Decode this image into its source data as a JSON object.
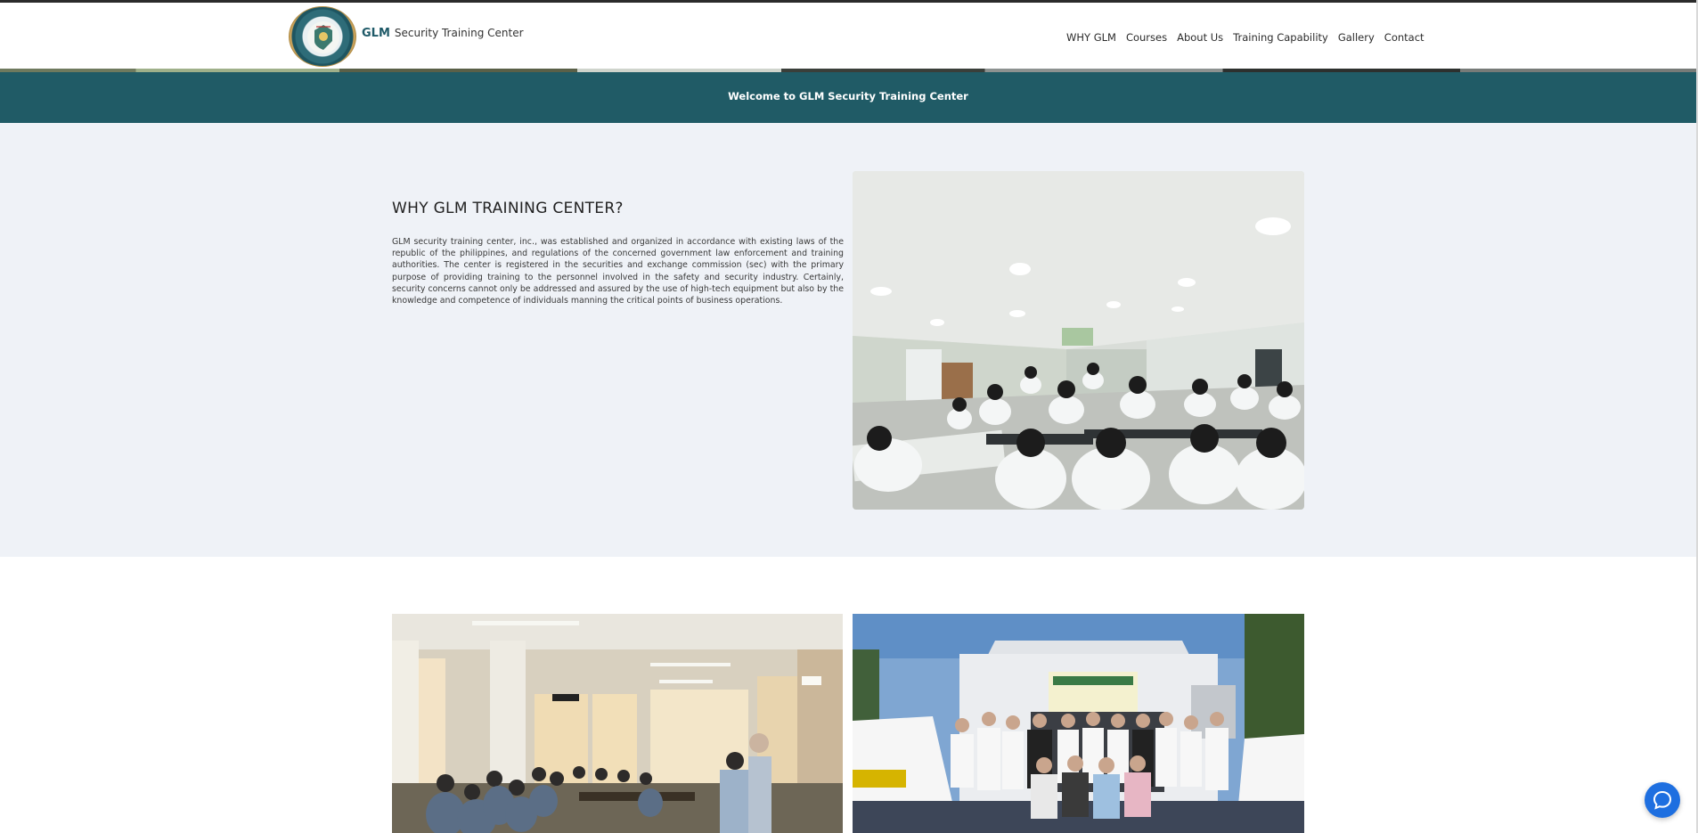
{
  "header": {
    "brand_strong": "GLM",
    "brand_rest": "Security Training Center",
    "logo_icon": "glm-seal-logo"
  },
  "nav": {
    "items": [
      {
        "label": "WHY GLM"
      },
      {
        "label": "Courses"
      },
      {
        "label": "About Us"
      },
      {
        "label": "Training Capability"
      },
      {
        "label": "Gallery"
      },
      {
        "label": "Contact"
      }
    ]
  },
  "banner": {
    "text": "Welcome to GLM Security Training Center"
  },
  "why": {
    "title": "WHY GLM TRAINING CENTER?",
    "body": "GLM security training center, inc., was established and organized in accordance with existing laws of the republic of the philippines, and regulations of the concerned government law enforcement and training authorities. The center is registered in the securities and exchange commission (sec) with the primary purpose of providing training to the personnel involved in the safety and security industry. Certainly, security concerns cannot only be addressed and assured by the use of high-tech equipment but also by the knowledge and competence of individuals manning the critical points of business operations."
  },
  "colors": {
    "brand_teal": "#205b66",
    "section_bg": "#eff2f7",
    "chat_blue": "#1e6fe0"
  },
  "chat": {
    "icon": "chat-bubble-icon"
  }
}
